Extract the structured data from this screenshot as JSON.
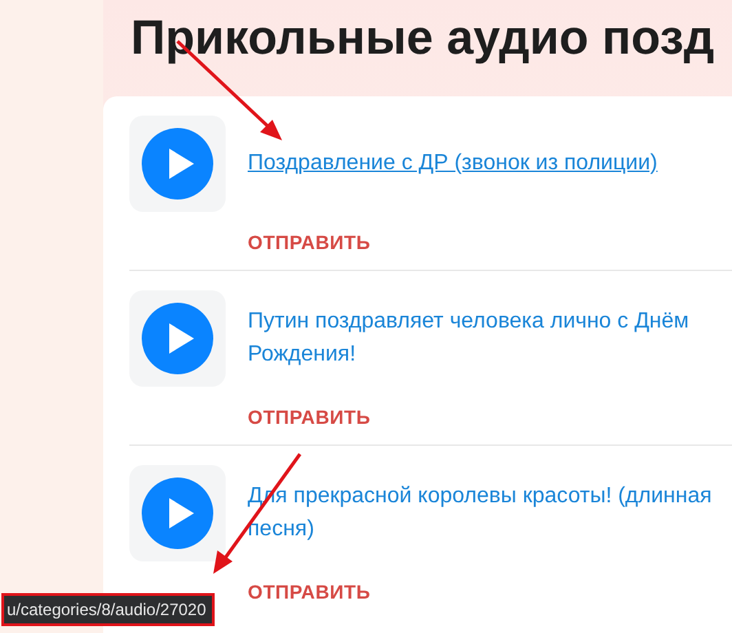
{
  "page_title": "Прикольные аудио позд",
  "audio_items": [
    {
      "title": "Поздравление с ДР (звонок из полиции)",
      "hovered": true,
      "action": "ОТПРАВИТЬ"
    },
    {
      "title": "Путин поздравляет человека лично с Днём Рождения!",
      "hovered": false,
      "action": "ОТПРАВИТЬ"
    },
    {
      "title": "Для прекрасной королевы красоты! (длинная песня)",
      "hovered": false,
      "action": "ОТПРАВИТЬ"
    }
  ],
  "status_bar": {
    "url": "u/categories/8/audio/27020",
    "highlighted": true
  }
}
